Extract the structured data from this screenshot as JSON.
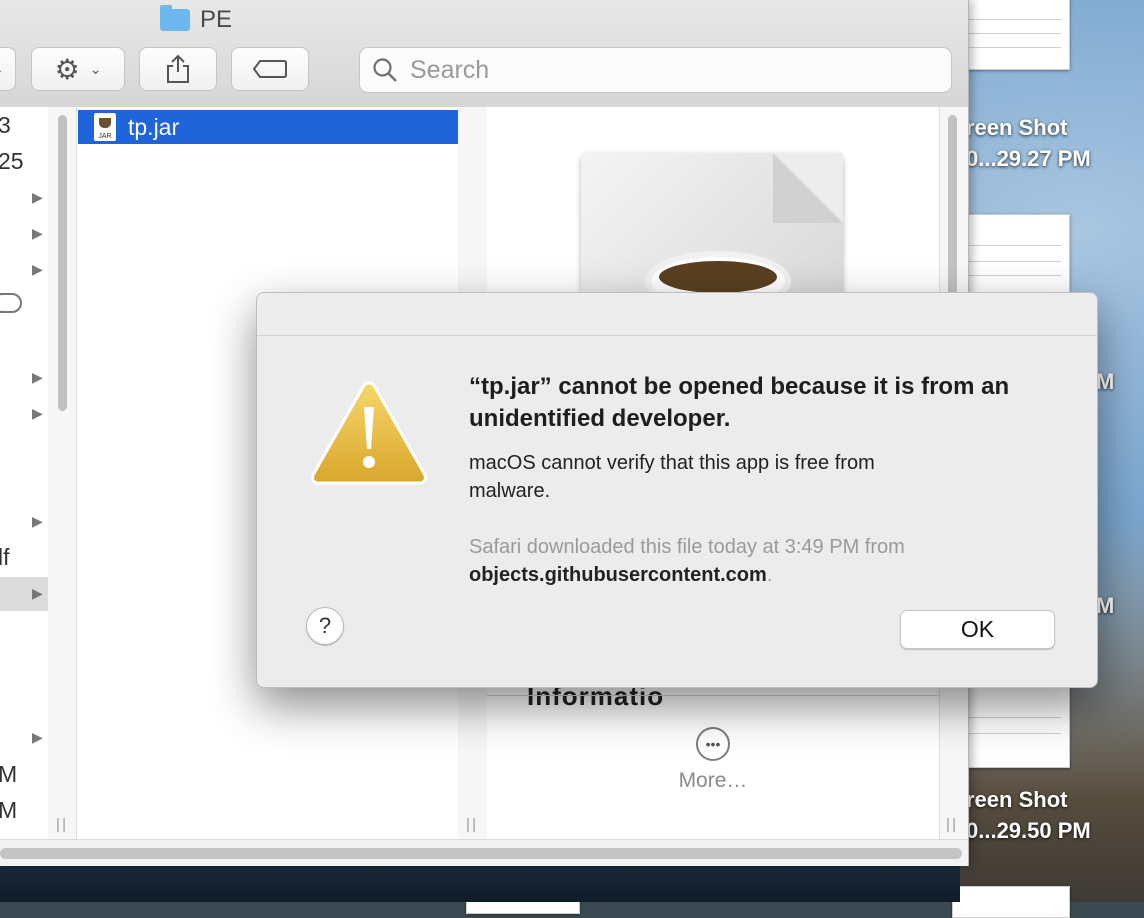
{
  "window": {
    "title": "PE"
  },
  "toolbar": {
    "search_placeholder": "Search"
  },
  "sidebar_partial": {
    "texts": [
      "3",
      "25",
      "lf",
      "M",
      "M"
    ]
  },
  "file_list": {
    "items": [
      {
        "name": "tp.jar",
        "icon_label": "JAR",
        "selected": true
      }
    ]
  },
  "preview": {
    "info_heading_partial": "Informatio",
    "more_label": "More…"
  },
  "desktop": {
    "labels": [
      {
        "line1": "reen Shot",
        "line2": "0...29.27 PM"
      },
      {
        "line1": "M"
      },
      {
        "line1": "M"
      },
      {
        "line1": "reen Shot",
        "line2": "0...29.50 PM"
      }
    ]
  },
  "alert": {
    "title": "“tp.jar” cannot be opened because it is from an unidentified developer.",
    "message": "macOS cannot verify that this app is free from malware.",
    "info_prefix": "Safari downloaded this file today at 3:49 PM from",
    "info_host": "objects.githubusercontent.com",
    "info_suffix": ".",
    "help_label": "?",
    "ok_label": "OK"
  },
  "colors": {
    "selection": "#1f64d8",
    "warning_icon": "#e2b33b"
  }
}
